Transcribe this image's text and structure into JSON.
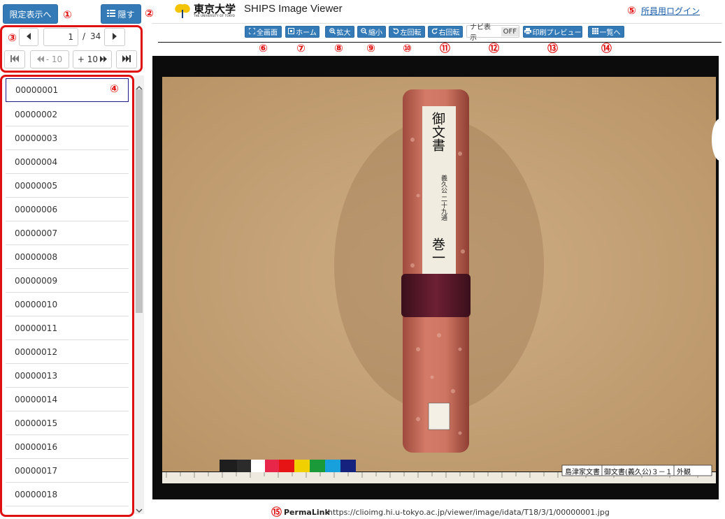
{
  "sidebar": {
    "limited_view_label": "限定表示へ",
    "hide_label": "隠す",
    "pager": {
      "current_page": "1",
      "separator": "/",
      "total_pages": "34",
      "minus10_label": "- 10",
      "plus10_label": "+ 10"
    },
    "items": [
      {
        "label": "00000001"
      },
      {
        "label": "00000002"
      },
      {
        "label": "00000003"
      },
      {
        "label": "00000004"
      },
      {
        "label": "00000005"
      },
      {
        "label": "00000006"
      },
      {
        "label": "00000007"
      },
      {
        "label": "00000008"
      },
      {
        "label": "00000009"
      },
      {
        "label": "00000010"
      },
      {
        "label": "00000011"
      },
      {
        "label": "00000012"
      },
      {
        "label": "00000013"
      },
      {
        "label": "00000014"
      },
      {
        "label": "00000015"
      },
      {
        "label": "00000016"
      },
      {
        "label": "00000017"
      },
      {
        "label": "00000018"
      }
    ]
  },
  "header": {
    "logo_text": "東京大学",
    "logo_subtext": "THE UNIVERSITY OF TOKYO",
    "app_title": "SHIPS Image Viewer",
    "login_link": "所員用ログイン"
  },
  "toolbar": {
    "fullscreen_label": "全画面",
    "home_label": "ホーム",
    "zoom_in_label": "拡大",
    "zoom_out_label": "縮小",
    "rotate_left_label": "左回転",
    "rotate_right_label": "右回転",
    "navi_label": "ナビ表示",
    "navi_state": "OFF",
    "print_label": "印刷プレビュー",
    "list_label": "一覧へ"
  },
  "annotations": {
    "n1": "①",
    "n2": "②",
    "n3": "③",
    "n4": "④",
    "n5": "⑤",
    "n6": "⑥",
    "n7": "⑦",
    "n8": "⑧",
    "n9": "⑨",
    "n10": "⑩",
    "n11": "⑪",
    "n12": "⑫",
    "n13": "⑬",
    "n14": "⑭",
    "n15": "⑮"
  },
  "viewer": {
    "scroll_label": "御文書",
    "scroll_subtitle": "義久公 二十九通",
    "scroll_volume": "巻一",
    "caption_collection": "島津家文書",
    "caption_title": "御文書(義久公)３－１",
    "caption_tag": "外観"
  },
  "footer": {
    "permalink_label": "PermaLink",
    "permalink_url": "https://clioimg.hi.u-tokyo.ac.jp/viewer/image/idata/T18/3/1/00000001.jpg"
  },
  "colors": {
    "accent": "#337ab7",
    "annotation_red": "#e01010",
    "paper_bg": "#c9a47c",
    "scroll_fabric": "#c96c5c",
    "scroll_band": "#5c1a2a"
  }
}
